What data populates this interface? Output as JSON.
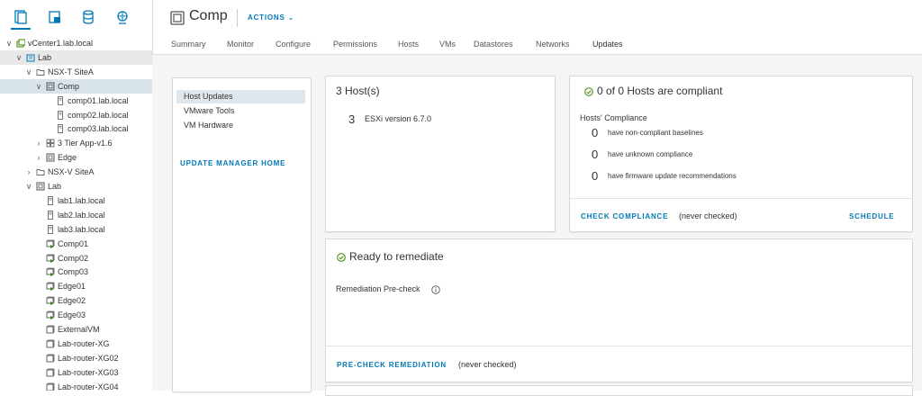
{
  "nav": {
    "tabs": [
      {
        "icon": "hosts-clusters-icon"
      },
      {
        "icon": "vms-templates-icon"
      },
      {
        "icon": "storage-icon"
      },
      {
        "icon": "networking-icon"
      }
    ],
    "tree": [
      {
        "label": "vCenter1.lab.local",
        "icon": "vcenter-icon",
        "chev": "open"
      },
      {
        "label": "Lab",
        "icon": "datacenter-icon",
        "chev": "open"
      },
      {
        "label": "NSX-T SiteA",
        "icon": "folder-icon",
        "chev": "open"
      },
      {
        "label": "Comp",
        "icon": "cluster-icon",
        "chev": "open"
      },
      {
        "label": "comp01.lab.local",
        "icon": "host-icon",
        "chev": ""
      },
      {
        "label": "comp02.lab.local",
        "icon": "host-icon",
        "chev": ""
      },
      {
        "label": "comp03.lab.local",
        "icon": "host-icon",
        "chev": ""
      },
      {
        "label": "3 Tier App-v1.6",
        "icon": "vapp-icon",
        "chev": "closed"
      },
      {
        "label": "Edge",
        "icon": "cluster-icon",
        "chev": "closed"
      },
      {
        "label": "NSX-V SiteA",
        "icon": "folder-icon",
        "chev": "closed"
      },
      {
        "label": "Lab",
        "icon": "cluster-icon",
        "chev": "open"
      },
      {
        "label": "lab1.lab.local",
        "icon": "host-icon",
        "chev": ""
      },
      {
        "label": "lab2.lab.local",
        "icon": "host-icon",
        "chev": ""
      },
      {
        "label": "lab3.lab.local",
        "icon": "host-icon",
        "chev": ""
      },
      {
        "label": "Comp01",
        "icon": "vm-icon",
        "chev": ""
      },
      {
        "label": "Comp02",
        "icon": "vm-icon",
        "chev": ""
      },
      {
        "label": "Comp03",
        "icon": "vm-icon",
        "chev": ""
      },
      {
        "label": "Edge01",
        "icon": "vm-icon",
        "chev": ""
      },
      {
        "label": "Edge02",
        "icon": "vm-icon",
        "chev": ""
      },
      {
        "label": "Edge03",
        "icon": "vm-icon",
        "chev": ""
      },
      {
        "label": "ExternalVM",
        "icon": "vm-off-icon",
        "chev": ""
      },
      {
        "label": "Lab-router-XG",
        "icon": "vm-off-icon",
        "chev": ""
      },
      {
        "label": "Lab-router-XG02",
        "icon": "vm-off-icon",
        "chev": ""
      },
      {
        "label": "Lab-router-XG03",
        "icon": "vm-off-icon",
        "chev": ""
      },
      {
        "label": "Lab-router-XG04",
        "icon": "vm-off-icon",
        "chev": ""
      }
    ]
  },
  "header": {
    "title": "Comp",
    "actions_label": "ACTIONS"
  },
  "tabs": [
    "Summary",
    "Monitor",
    "Configure",
    "Permissions",
    "Hosts",
    "VMs",
    "Datastores",
    "Networks",
    "Updates"
  ],
  "active_tab": "Updates",
  "left_menu": {
    "items": [
      "Host Updates",
      "VMware Tools",
      "VM Hardware"
    ],
    "home_link": "UPDATE MANAGER HOME"
  },
  "hosts_card": {
    "title": "3 Host(s)",
    "count": "3",
    "version": "ESXi version 6.7.0"
  },
  "compliance_card": {
    "title": "0 of 0 Hosts are compliant",
    "section": "Hosts' Compliance",
    "rows": [
      {
        "count": "0",
        "text": "have non-compliant baselines"
      },
      {
        "count": "0",
        "text": "have unknown compliance"
      },
      {
        "count": "0",
        "text": "have firmware update recommendations"
      }
    ],
    "check_link": "CHECK COMPLIANCE",
    "check_status": "(never checked)",
    "schedule_link": "SCHEDULE"
  },
  "remediate_card": {
    "title": "Ready to remediate",
    "precheck_label": "Remediation Pre-check",
    "precheck_link": "PRE-CHECK REMEDIATION",
    "precheck_status": "(never checked)"
  },
  "colors": {
    "accent": "#0079b8",
    "ok_green": "#3c8500",
    "vm_green": "#3c8500"
  }
}
